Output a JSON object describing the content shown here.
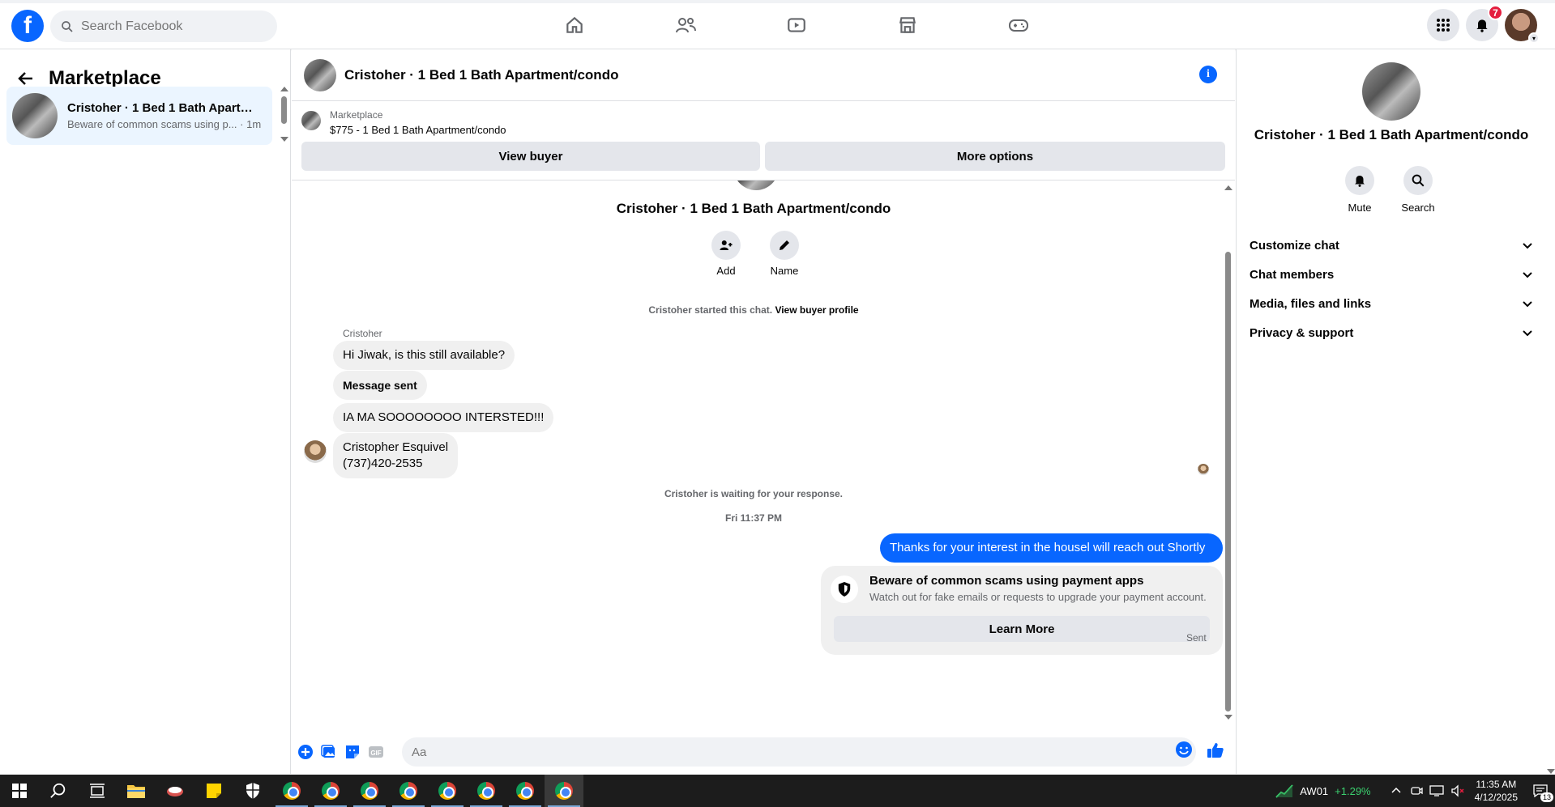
{
  "topnav": {
    "search_placeholder": "Search Facebook",
    "notifications_count": "7",
    "logo_letter": "f"
  },
  "left": {
    "title": "Marketplace",
    "conversation": {
      "title": "Cristoher · 1 Bed 1 Bath Apartme...",
      "preview": "Beware of common scams using p... · 1m"
    }
  },
  "chat": {
    "header_title": "Cristoher · 1 Bed 1 Bath Apartment/condo",
    "marketplace_label": "Marketplace",
    "listing": "$775 - 1 Bed 1 Bath Apartment/condo",
    "view_buyer": "View buyer",
    "more_options": "More options",
    "hero_name": "Cristoher · 1 Bed 1 Bath Apartment/condo",
    "add_label": "Add",
    "name_label": "Name",
    "started_text": "Cristoher started this chat.",
    "view_profile": "View buyer profile",
    "sender_name": "Cristoher",
    "messages": [
      "Hi Jiwak, is this still available?",
      "Message sent",
      "IA MA SOOOOOOOO INTERSTED!!!",
      "Cristopher Esquivel",
      "(737)420-2535"
    ],
    "waiting_text": "Cristoher is waiting for your response.",
    "timestamp": "Fri 11:37 PM",
    "outgoing": "Thanks for your interest in the housel will reach out Shortly",
    "scam_title": "Beware of common scams using payment apps",
    "scam_sub": "Watch out for fake emails or requests to upgrade your payment account.",
    "learn_more": "Learn More",
    "sent_label": "Sent",
    "composer_placeholder": "Aa"
  },
  "right": {
    "name": "Cristoher · 1 Bed 1 Bath Apartment/condo",
    "mute": "Mute",
    "search": "Search",
    "sections": [
      "Customize chat",
      "Chat members",
      "Media, files and links",
      "Privacy & support"
    ]
  },
  "taskbar": {
    "ticker": "AW01",
    "change": "+1.29%",
    "time": "11:35 AM",
    "date": "4/12/2025",
    "notif_count": "13"
  },
  "colors": {
    "brand": "#0866ff",
    "outgoing_bubble": "#0866ff",
    "incoming_bubble": "#f0f0f0",
    "badge": "#e41e3f"
  }
}
